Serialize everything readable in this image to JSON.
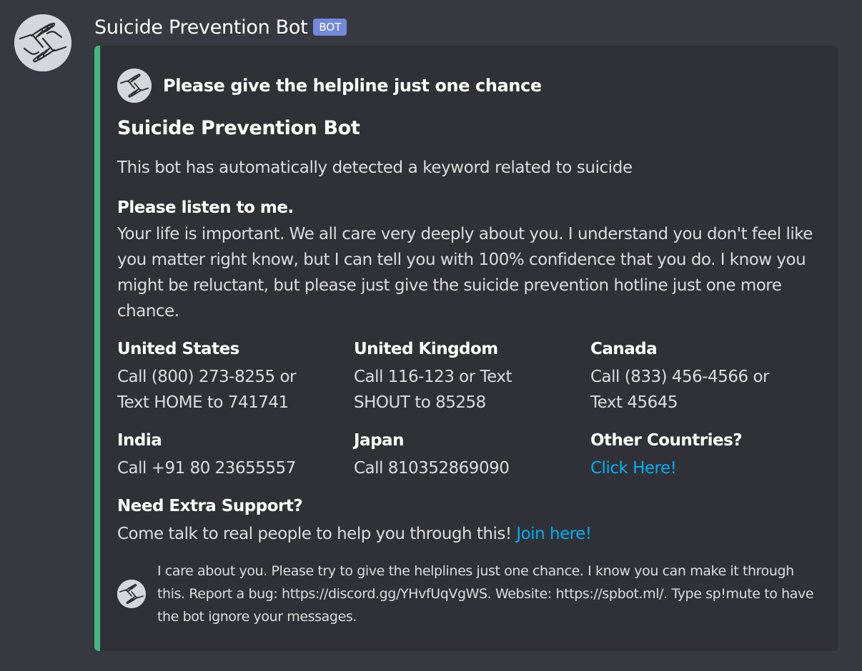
{
  "message": {
    "username": "Suicide Prevention Bot",
    "bot_tag": "BOT",
    "avatar_icon": "helping-hands-icon"
  },
  "embed": {
    "accent_color": "#43b581",
    "author": {
      "name": "Please give the helpline just one chance",
      "icon": "helping-hands-icon"
    },
    "title": "Suicide Prevention Bot",
    "description": "This bot has automatically detected a keyword related to suicide",
    "fields": {
      "listen": {
        "name": "Please listen to me.",
        "value": "Your life is important. We all care very deeply about you. I understand you don't feel like you matter right know, but I can tell you with 100% confidence that you do. I know you might be reluctant, but please just give the suicide prevention hotline just one more chance."
      },
      "us": {
        "name": "United States",
        "value": "Call (800) 273-8255 or Text HOME to 741741"
      },
      "uk": {
        "name": "United Kingdom",
        "value": "Call 116-123 or Text SHOUT to 85258"
      },
      "canada": {
        "name": "Canada",
        "value": "Call (833) 456-4566 or Text 45645"
      },
      "india": {
        "name": "India",
        "value": "Call +91 80 23655557"
      },
      "japan": {
        "name": "Japan",
        "value": "Call 810352869090"
      },
      "other": {
        "name": "Other Countries?",
        "link_text": "Click Here!"
      },
      "support": {
        "name": "Need Extra Support?",
        "value": "Come talk to real people to help you through this!",
        "link_text": "Join here!"
      }
    },
    "footer": {
      "text": "I care about you. Please try to give the helplines just one chance. I know you can make it through this. Report a bug: https://discord.gg/YHvfUqVgWS. Website: https://spbot.ml/. Type sp!mute to have the bot ignore your messages.",
      "icon": "helping-hands-icon"
    }
  },
  "colors": {
    "background": "#36393f",
    "embed_background": "#2f3136",
    "bot_tag": "#7289da",
    "link": "#00aff4"
  }
}
